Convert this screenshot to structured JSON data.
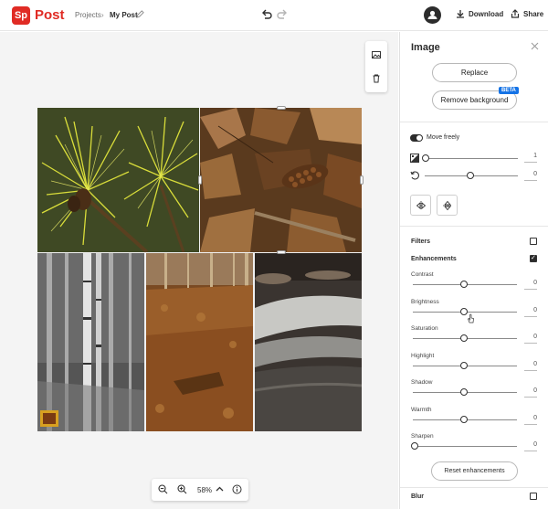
{
  "app": {
    "logo_text": "Sp",
    "brand": "Post"
  },
  "breadcrumb": {
    "projects": "Projects",
    "separator": "›",
    "current": "My Post"
  },
  "header": {
    "download_label": "Download",
    "share_label": "Share"
  },
  "canvas": {
    "zoom": "58%"
  },
  "panel": {
    "title": "Image",
    "replace_label": "Replace",
    "remove_bg_label": "Remove background",
    "beta_badge": "BETA",
    "move_freely_label": "Move freely",
    "opacity_value": "1",
    "rotation_value": "0",
    "filters_label": "Filters",
    "filters_checked": false,
    "enhancements_label": "Enhancements",
    "enhancements_checked": true,
    "sliders": [
      {
        "label": "Contrast",
        "value": "0"
      },
      {
        "label": "Brightness",
        "value": "0"
      },
      {
        "label": "Saturation",
        "value": "0"
      },
      {
        "label": "Highlight",
        "value": "0"
      },
      {
        "label": "Shadow",
        "value": "0"
      },
      {
        "label": "Warmth",
        "value": "0"
      },
      {
        "label": "Sharpen",
        "value": "0"
      }
    ],
    "reset_label": "Reset enhancements",
    "blur_label": "Blur",
    "blur_checked": false
  },
  "colors": {
    "brand": "#e02b24",
    "beta": "#1473e6"
  }
}
